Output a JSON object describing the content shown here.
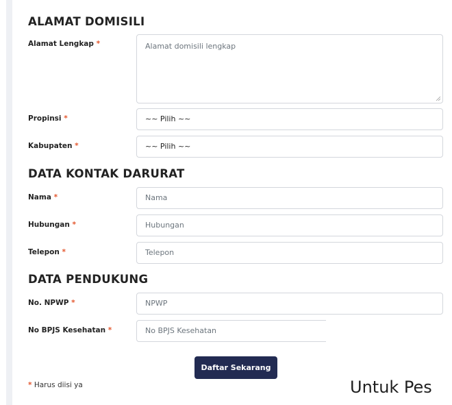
{
  "sections": {
    "domicile": {
      "title": "ALAMAT DOMISILI"
    },
    "emergency": {
      "title": "DATA KONTAK DARURAT"
    },
    "support": {
      "title": "DATA PENDUKUNG"
    }
  },
  "fields": {
    "full_address": {
      "label": "Alamat Lengkap",
      "placeholder": "Alamat domisili lengkap"
    },
    "province": {
      "label": "Propinsi",
      "value": "~~ Pilih ~~"
    },
    "regency": {
      "label": "Kabupaten",
      "value": "~~ Pilih ~~"
    },
    "name": {
      "label": "Nama",
      "placeholder": "Nama"
    },
    "relationship": {
      "label": "Hubungan",
      "placeholder": "Hubungan"
    },
    "phone": {
      "label": "Telepon",
      "placeholder": "Telepon"
    },
    "npwp": {
      "label": "No. NPWP",
      "placeholder": "NPWP"
    },
    "bpjs": {
      "label": "No BPJS Kesehatan",
      "placeholder": "No BPJS Kesehatan"
    }
  },
  "required_mark": "*",
  "submit_label": "Daftar Sekarang",
  "footnote": {
    "mark": "*",
    "text": "Harus diisi ya"
  },
  "overlay_text": "Untuk Pes",
  "colors": {
    "required": "#e4572e",
    "button": "#222b52",
    "border": "#d3d6dc"
  }
}
